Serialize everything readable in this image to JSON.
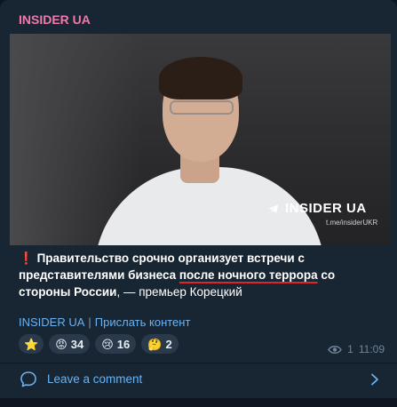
{
  "channel": {
    "name": "INSIDER UA"
  },
  "photo": {
    "watermark": "INSIDER UA",
    "watermark_sub": "t.me/insiderUKR",
    "watermark_icon": "telegram-icon"
  },
  "message": {
    "exclamation": "❗",
    "part1": "Правительство срочно организует встречи с представителями бизнеса ",
    "part2": "после ночного террора",
    "part3": " со стороны России",
    "part4": ", — премьер Корецкий"
  },
  "links": {
    "channel": "INSIDER UA",
    "separator": "|",
    "submit": "Прислать контент"
  },
  "reactions": [
    {
      "emoji": "⭐",
      "count": "",
      "icon": "star-icon"
    },
    {
      "emoji": "😡",
      "count": "34",
      "icon": "angry-face-icon"
    },
    {
      "emoji": "😢",
      "count": "16",
      "icon": "crying-face-icon"
    },
    {
      "emoji": "🤔",
      "count": "2",
      "icon": "thinking-face-icon"
    }
  ],
  "meta": {
    "views": "1",
    "time": "11:09"
  },
  "comment": {
    "label": "Leave a comment"
  },
  "colors": {
    "accent": "#6ab2f2",
    "channel": "#f07aa9",
    "bg": "#182533"
  }
}
